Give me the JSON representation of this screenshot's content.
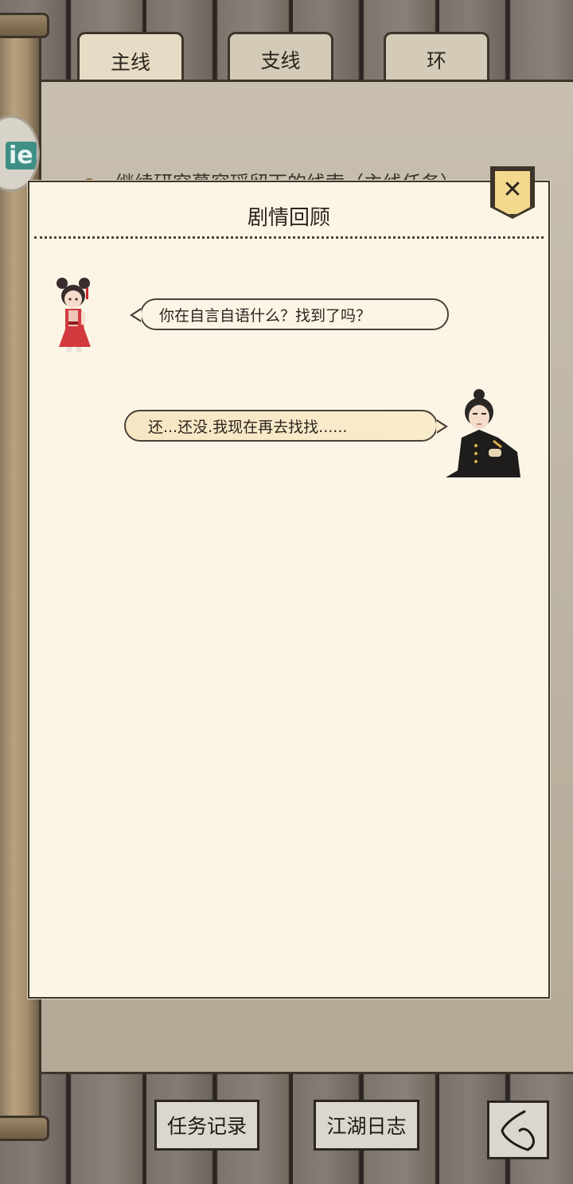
{
  "tabs": [
    {
      "label": "主线",
      "active": true
    },
    {
      "label": "支线",
      "active": false
    },
    {
      "label": "环",
      "active": false
    }
  ],
  "side_badge": "ie",
  "task_line": "继续研究慕容瑶留下的线索（主线任务）",
  "dialog": {
    "title": "剧情回顾",
    "close_icon": "close-icon",
    "messages": [
      {
        "speaker_side": "left",
        "text": "你在自言自语什么？找到了吗？"
      },
      {
        "speaker_side": "right",
        "text": "还...还没.我现在再去找找......"
      }
    ]
  },
  "bottom": {
    "record_label": "任务记录",
    "journal_label": "江湖日志",
    "back_icon": "back-arrow-icon"
  },
  "colors": {
    "parchment": "#fcf5e5",
    "close_badge": "#f3d98e",
    "ink": "#3d342a",
    "bubble_highlight": "#f6e7c4"
  }
}
